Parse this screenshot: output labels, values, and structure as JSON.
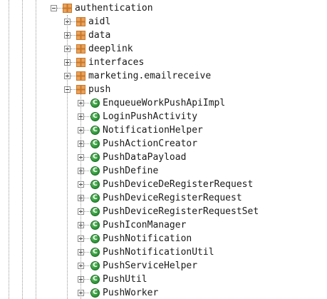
{
  "tree": {
    "parent": {
      "label": "authentication",
      "expanded": true,
      "icon": "package-icon"
    },
    "packages": [
      {
        "label": "aidl",
        "expanded": false,
        "icon": "package-icon"
      },
      {
        "label": "data",
        "expanded": false,
        "icon": "package-icon"
      },
      {
        "label": "deeplink",
        "expanded": false,
        "icon": "package-icon"
      },
      {
        "label": "interfaces",
        "expanded": false,
        "icon": "package-icon"
      },
      {
        "label": "marketing.emailreceive",
        "expanded": false,
        "icon": "package-icon"
      },
      {
        "label": "push",
        "expanded": true,
        "icon": "package-icon"
      }
    ],
    "class_icon_letter": "C",
    "classes": [
      {
        "label": "EnqueueWorkPushApiImpl"
      },
      {
        "label": "LoginPushActivity"
      },
      {
        "label": "NotificationHelper"
      },
      {
        "label": "PushActionCreator"
      },
      {
        "label": "PushDataPayload"
      },
      {
        "label": "PushDefine"
      },
      {
        "label": "PushDeviceDeRegisterRequest"
      },
      {
        "label": "PushDeviceRegisterRequest"
      },
      {
        "label": "PushDeviceRegisterRequestSet"
      },
      {
        "label": "PushIconManager"
      },
      {
        "label": "PushNotification"
      },
      {
        "label": "PushNotificationUtil"
      },
      {
        "label": "PushServiceHelper"
      },
      {
        "label": "PushUtil"
      },
      {
        "label": "PushWorker"
      }
    ],
    "colors": {
      "class_icon_green": "#2f9a3a",
      "package_icon_orange": "#c8782a",
      "guide_line": "#9a9a9a"
    }
  }
}
